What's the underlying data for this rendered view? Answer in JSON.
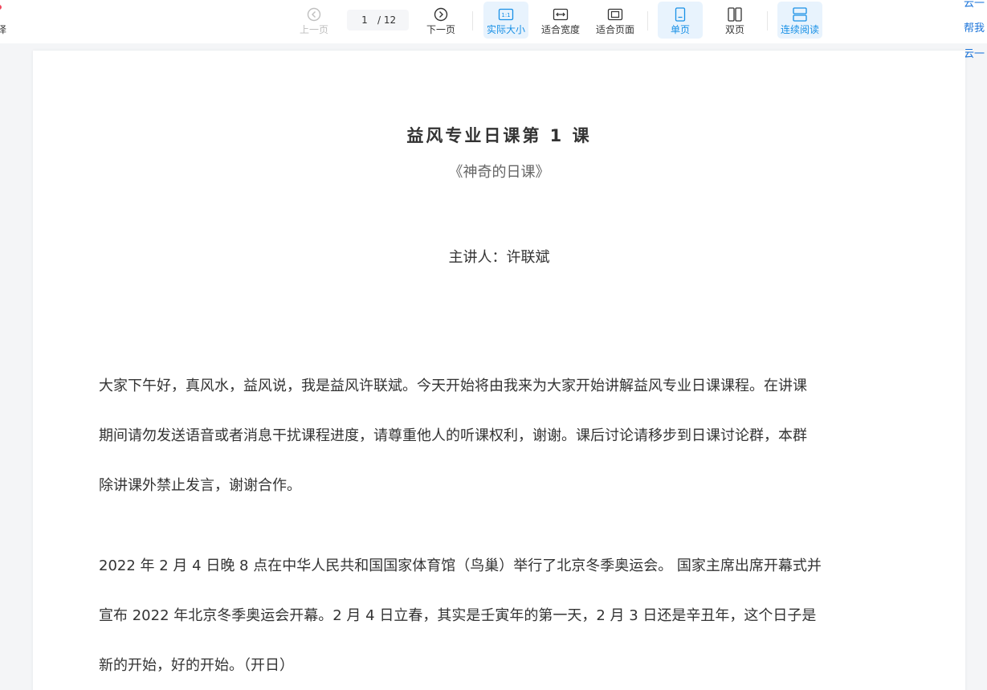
{
  "left_stub": {
    "label": "译"
  },
  "toolbar": {
    "prev": "上一页",
    "page_current": "1",
    "page_total": "/ 12",
    "next": "下一页",
    "actual_size": "实际大小",
    "actual_size_icon_text": "1:1",
    "fit_width": "适合宽度",
    "fit_page": "适合页面",
    "single_page": "单页",
    "double_page": "双页",
    "continuous": "连续阅读"
  },
  "right_links": [
    "云一",
    "帮我",
    "云一"
  ],
  "colors": {
    "accent": "#1890e6",
    "active_bg": "#e8f3fd",
    "disabled": "#bfbfbf"
  },
  "document": {
    "title": "益风专业日课第 1 课",
    "subtitle": "《神奇的日课》",
    "speaker": "主讲人：许联斌",
    "paragraph1_lines": [
      "大家下午好，真风水，益风说，我是益风许联斌。今天开始将由我来为大家开始讲解益风专业日课课程。在讲课",
      "期间请勿发送语音或者消息干扰课程进度，请尊重他人的听课权利，谢谢。课后讨论请移步到日课讨论群，本群",
      "除讲课外禁止发言，谢谢合作。"
    ],
    "paragraph2_lines": [
      "2022 年 2 月 4 日晚 8 点在中华人民共和国国家体育馆（鸟巢）举行了北京冬季奥运会。 国家主席出席开幕式并",
      "宣布 2022 年北京冬季奥运会开幕。2 月 4 日立春，其实是壬寅年的第一天，2 月 3 日还是辛丑年，这个日子是",
      "新的开始，好的开始。（开日）"
    ]
  }
}
